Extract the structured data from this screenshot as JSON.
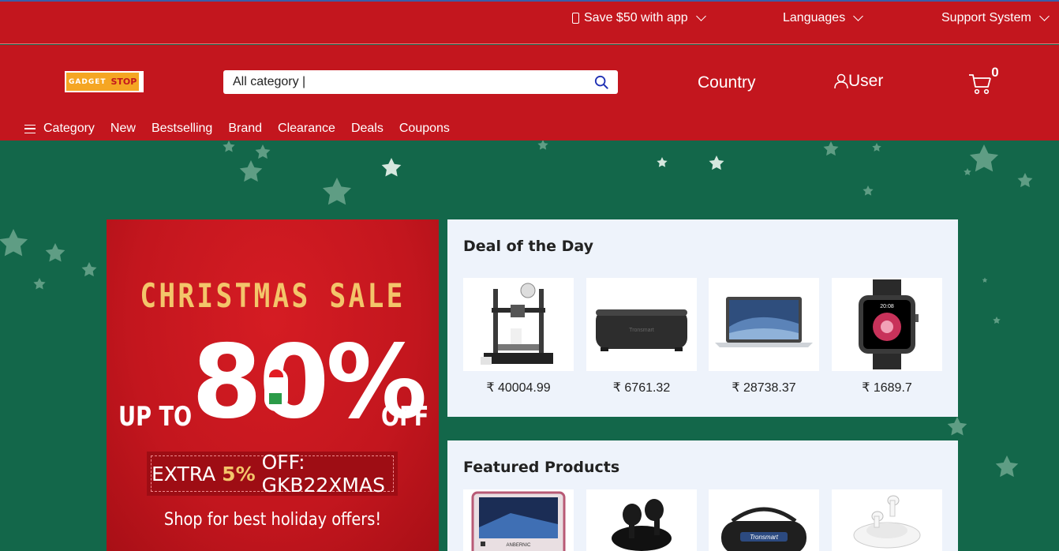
{
  "topbar": {
    "app_offer": "Save $50 with app",
    "languages": "Languages",
    "support": "Support System"
  },
  "logo": {
    "part1": "GADGET",
    "part2": "STOP"
  },
  "search": {
    "value": "All category |"
  },
  "header": {
    "country": "Country",
    "user": "User",
    "cart_count": "0"
  },
  "nav": {
    "category": "Category",
    "items": [
      "New",
      "Bestselling",
      "Brand",
      "Clearance",
      "Deals",
      "Coupons"
    ]
  },
  "banner": {
    "title": "CHRISTMAS SALE",
    "up_to": "UP TO",
    "percent": "80%",
    "off": "OFF",
    "code_prefix": "EXTRA",
    "code_pct": "5%",
    "code_suffix": "OFF: GKB22XMAS",
    "tagline": "Shop for best holiday offers!"
  },
  "deal_of_day": {
    "title": "Deal of the Day",
    "products": [
      {
        "icon": "3d-printer-icon",
        "price": "₹ 40004.99"
      },
      {
        "icon": "speaker-icon",
        "price": "₹ 6761.32"
      },
      {
        "icon": "laptop-icon",
        "price": "₹ 28738.37"
      },
      {
        "icon": "smartwatch-icon",
        "price": "₹ 1689.7"
      }
    ]
  },
  "featured": {
    "title": "Featured Products",
    "products": [
      {
        "icon": "handheld-console-icon",
        "brand_text": "ANBERNIC"
      },
      {
        "icon": "earbuds-icon",
        "brand_text": ""
      },
      {
        "icon": "portable-speaker-icon",
        "brand_text": "Tronsmart"
      },
      {
        "icon": "airpods-icon",
        "brand_text": ""
      }
    ]
  },
  "colors": {
    "brand_red": "#c3161e",
    "background_green": "#13674a",
    "panel_bg": "#eef3fb",
    "accent_gold": "#f3c56a"
  }
}
